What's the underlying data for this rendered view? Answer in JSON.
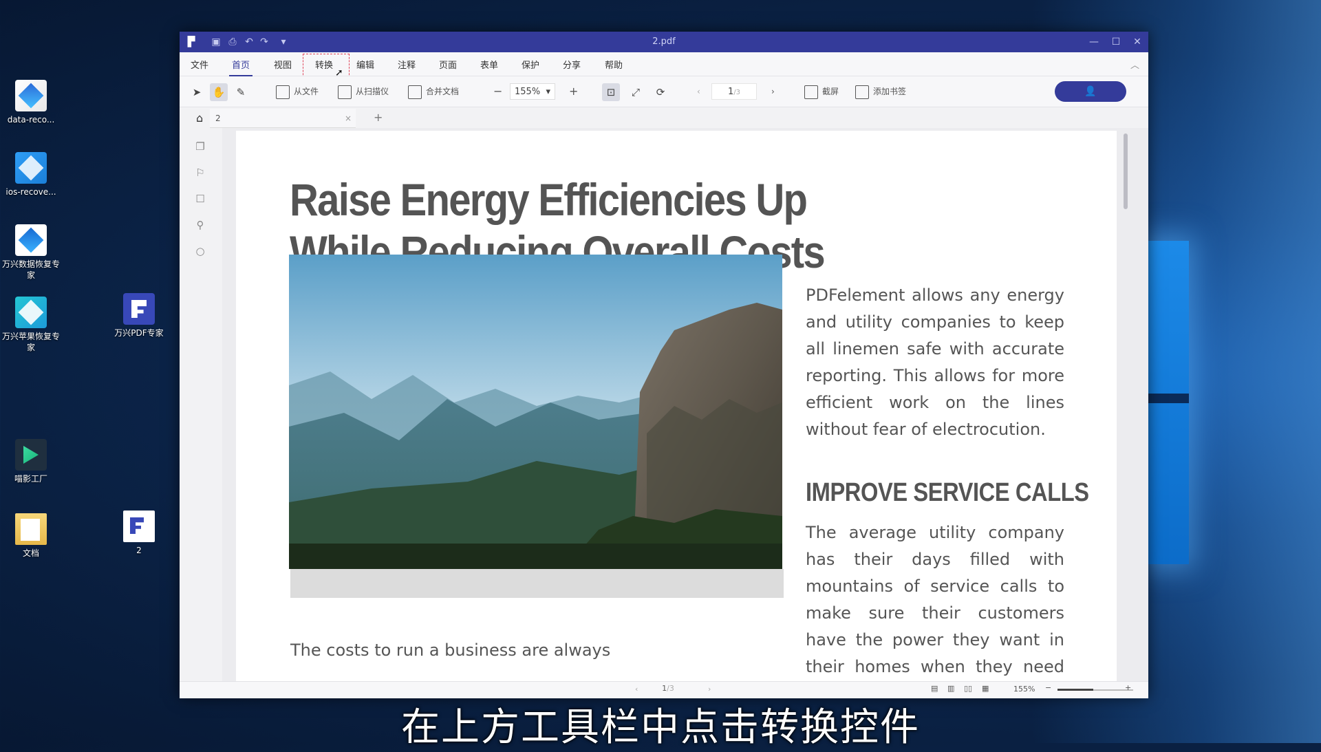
{
  "desktop": {
    "icons": [
      {
        "label": "data-reco...",
        "icon": "data-recovery-app-icon"
      },
      {
        "label": "ios-recove...",
        "icon": "ios-recovery-app-icon"
      },
      {
        "label": "万兴数据恢复专家",
        "icon": "wondershare-data-recovery-icon"
      },
      {
        "label": "万兴苹果恢复专家",
        "icon": "wondershare-iphone-recovery-icon"
      },
      {
        "label": "万兴PDF专家",
        "icon": "wondershare-pdf-icon"
      },
      {
        "label": "喵影工厂",
        "icon": "filmora-icon"
      },
      {
        "label": "文档",
        "icon": "folder-icon"
      },
      {
        "label": "2",
        "icon": "pdf-file-icon"
      }
    ]
  },
  "window": {
    "title": "2.pdf",
    "accent": "#343b9a"
  },
  "menu": {
    "items": [
      "文件",
      "首页",
      "视图",
      "转换",
      "编辑",
      "注释",
      "页面",
      "表单",
      "保护",
      "分享",
      "帮助"
    ],
    "active": "首页",
    "highlighted": "转换"
  },
  "toolbar": {
    "from_file": "从文件",
    "from_scanner": "从扫描仪",
    "merge": "合并文档",
    "zoom": "155%",
    "page": "1",
    "page_total": "/3",
    "screenshot": "截屏",
    "add_bookmark": "添加书签"
  },
  "tab": {
    "name": "2"
  },
  "document": {
    "title": "Raise Energy Efficiencies Up While Reducing Overall Costs",
    "right_paragraph": "PDFelement allows any energy and utility companies to keep all linemen safe with accurate reporting. This allows for more efficient work on the lines without fear of electrocution.",
    "section_heading": "IMPROVE SERVICE CALLS",
    "right_paragraph_2": "The average utility company has their days filled with mountains of service calls to make sure their customers have the power they want in their homes when they need it. This can",
    "left_paragraph": "The costs to run a business are always"
  },
  "status": {
    "page": "1",
    "page_total": "/3",
    "zoom": "155%"
  },
  "subtitle": "在上方工具栏中点击转换控件"
}
